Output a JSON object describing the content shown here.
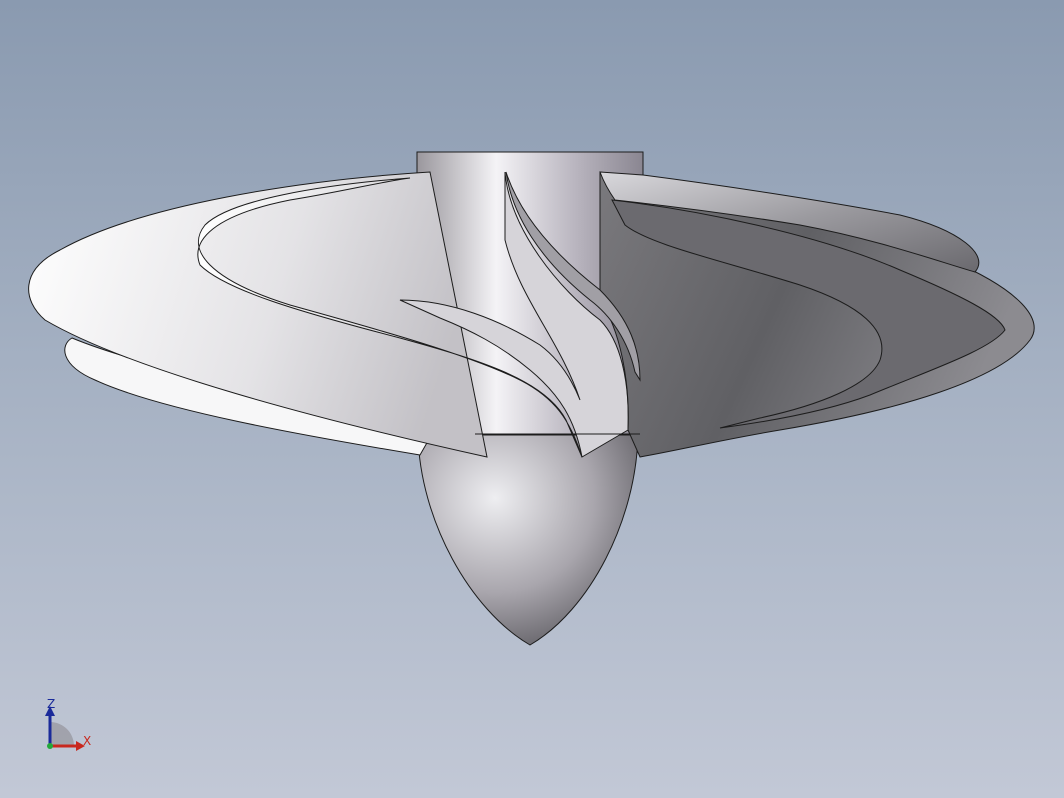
{
  "viewport": {
    "background_top": "#8a9ab0",
    "background_bottom": "#c2c8d6"
  },
  "model": {
    "name": "propeller-impeller-model",
    "shade_light": "#ffffff",
    "shade_mid": "#c4c2c8",
    "shade_dark": "#5e5e62",
    "edge_color": "#1c1c1c"
  },
  "triad": {
    "z_label": "Z",
    "x_label": "X",
    "z_color": "#1a2a9a",
    "x_color": "#c8281e",
    "origin_color": "#22a83a"
  }
}
